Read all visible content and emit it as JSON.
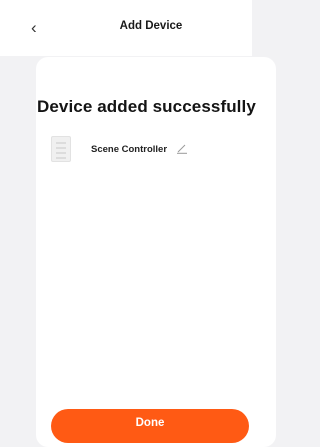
{
  "header": {
    "title": "Add Device",
    "back_icon": "chevron-left-icon"
  },
  "main": {
    "headline": "Device added successfully",
    "device": {
      "name": "Scene Controller",
      "icon": "scene-controller-device-icon",
      "edit_icon": "pencil-icon"
    },
    "done_label": "Done"
  },
  "colors": {
    "accent": "#ff5a14",
    "background": "#f2f2f4",
    "card": "#ffffff"
  }
}
